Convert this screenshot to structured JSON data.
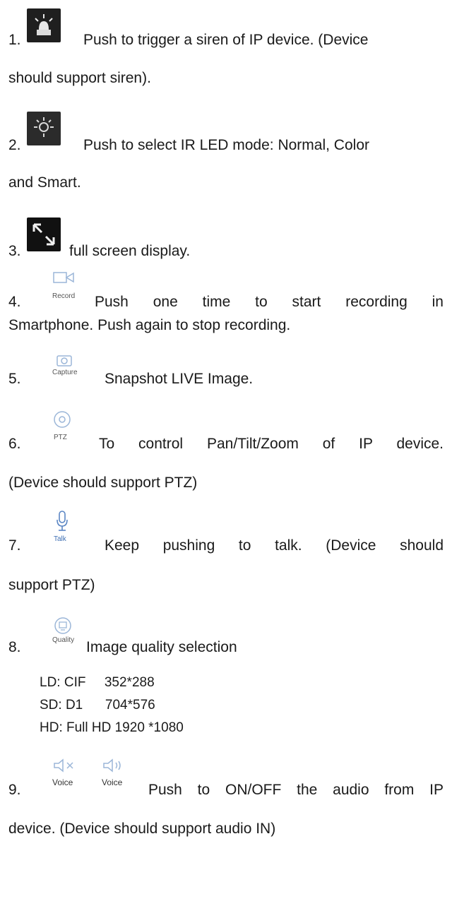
{
  "items": [
    {
      "number": "1.",
      "icon": "siren-icon",
      "line1": "Push to trigger a siren of IP device. (Device",
      "line2": "should support siren)."
    },
    {
      "number": "2.",
      "icon": "ir-led-icon",
      "line1": "Push to select IR LED mode: Normal, Color",
      "line2": "and Smart."
    },
    {
      "number": "3.",
      "icon": "fullscreen-icon",
      "line1": "full screen display."
    },
    {
      "number": "4.",
      "icon": "record-icon",
      "icon_label": "Record",
      "line1": "Push one time to start recording in",
      "line2": "Smartphone. Push again to stop recording."
    },
    {
      "number": "5.",
      "icon": "capture-icon",
      "icon_label": "Capture",
      "line1": "Snapshot LIVE Image."
    },
    {
      "number": "6.",
      "icon": "ptz-icon",
      "icon_label": "PTZ",
      "line1": "To control Pan/Tilt/Zoom of IP device.",
      "line2": "(Device should support PTZ)"
    },
    {
      "number": "7.",
      "icon": "microphone-icon",
      "icon_label": "Talk",
      "line1": "Keep pushing to talk. (Device should",
      "line2": "support PTZ)"
    },
    {
      "number": "8.",
      "icon": "quality-icon",
      "icon_label": "Quality",
      "line1": "Image quality selection",
      "sub_rows": [
        "LD: CIF     352*288",
        "SD: D1      704*576",
        "HD: Full HD 1920 *1080"
      ]
    },
    {
      "number": "9.",
      "icon": "speaker-icon",
      "icon_label": "Voice",
      "icon_label_2": "Voice",
      "line1": "Push to ON/OFF the audio from IP",
      "line2": "device. (Device should support audio IN)"
    }
  ],
  "colors": {
    "text": "#1a1a1a",
    "icon_dark": "#1f1f1f",
    "icon_light": "#9bb6d8"
  }
}
